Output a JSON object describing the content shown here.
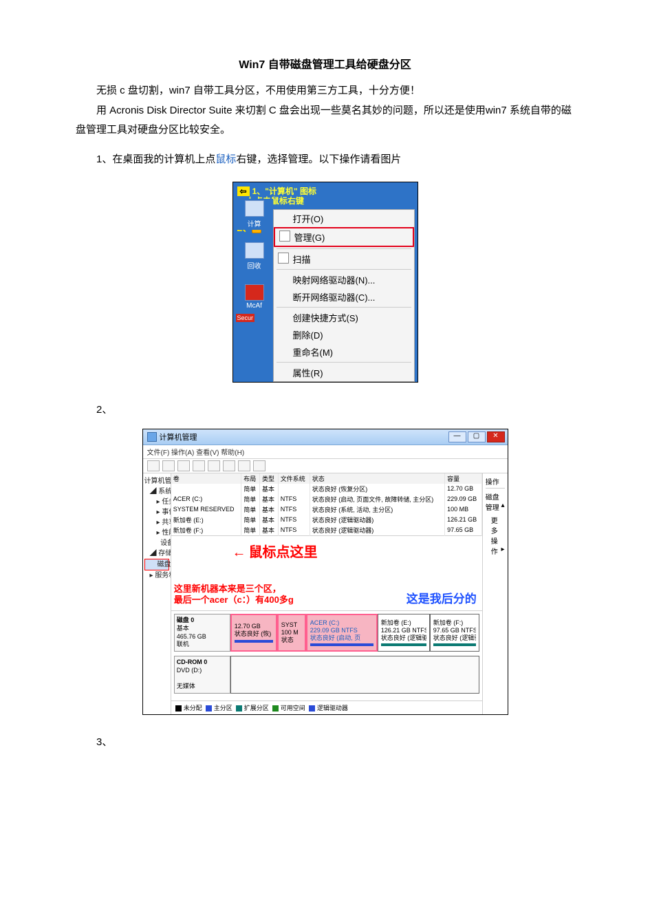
{
  "title": "Win7 自带磁盘管理工具给硬盘分区",
  "p1": "无损 c 盘切割，win7 自带工具分区，不用使用第三方工具，十分方便！",
  "p2": "用 Acronis Disk Director Suite 来切割 C 盘会出现一些莫名其妙的问题，所以还是使用win7 系统自带的磁盘管理工具对硬盘分区比较安全。",
  "step1_pre": "1、在桌面我的计算机上点",
  "step1_link": "鼠标",
  "step1_post": "右键，选择管理。以下操作请看图片",
  "step2": "2、",
  "step3": "3、",
  "fig1": {
    "tip_1a": "1、",
    "tip_1b": "\"计算机\" 图标",
    "tip_1c": "上点击鼠标右键",
    "tag2": "2、",
    "desk_comp": "计算",
    "desk_trash": "回收",
    "desk_mcafee_a": "McAf",
    "desk_mcafee_b": "Secur",
    "menu": {
      "open": "打开(O)",
      "manage": "管理(G)",
      "scan": "扫描",
      "map": "映射网络驱动器(N)...",
      "unmap": "断开网络驱动器(C)...",
      "shortcut": "创建快捷方式(S)",
      "delete": "删除(D)",
      "rename": "重命名(M)",
      "prop": "属性(R)"
    }
  },
  "fig2": {
    "title": "计算机管理",
    "menubar": "文件(F)  操作(A)  查看(V)  帮助(H)",
    "tree": {
      "root": "计算机管理(本地)",
      "systools": "系统工具",
      "task": "任务计划程序",
      "event": "事件查看器",
      "share": "共享文件夹",
      "perf": "性能",
      "devmgr": "设备管理器",
      "storage": "存储",
      "diskmgmt": "磁盘管理",
      "services": "服务和应用程序"
    },
    "callout_click": "鼠标点这里",
    "headers": {
      "vol": "卷",
      "layout": "布局",
      "type": "类型",
      "fs": "文件系统",
      "status": "状态",
      "cap": "容量"
    },
    "rows": [
      {
        "vol": "",
        "layout": "简单",
        "type": "基本",
        "fs": "",
        "status": "状态良好 (恢复分区)",
        "cap": "12.70 GB"
      },
      {
        "vol": "ACER (C:)",
        "layout": "简单",
        "type": "基本",
        "fs": "NTFS",
        "status": "状态良好 (启动, 页面文件, 故障转储, 主分区)",
        "cap": "229.09 GB"
      },
      {
        "vol": "SYSTEM RESERVED",
        "layout": "简单",
        "type": "基本",
        "fs": "NTFS",
        "status": "状态良好 (系统, 活动, 主分区)",
        "cap": "100 MB"
      },
      {
        "vol": "新加卷 (E:)",
        "layout": "简单",
        "type": "基本",
        "fs": "NTFS",
        "status": "状态良好 (逻辑驱动器)",
        "cap": "126.21 GB"
      },
      {
        "vol": "新加卷 (F:)",
        "layout": "简单",
        "type": "基本",
        "fs": "NTFS",
        "status": "状态良好 (逻辑驱动器)",
        "cap": "97.65 GB"
      }
    ],
    "annot_left_l1": "这里新机器本来是三个区，",
    "annot_left_l2": "最后一个acer（c：）有400多g",
    "annot_right": "这是我后分的",
    "disk0": {
      "name": "磁盘 0",
      "type": "基本",
      "size": "465.76 GB",
      "stat": "联机",
      "p_recovery_size": "12.70 GB",
      "p_recovery_stat": "状态良好 (恢)",
      "p_sys_name": "SYST",
      "p_sys_size": "100 M",
      "p_sys_stat": "状态",
      "p_c_name": "ACER (C:)",
      "p_c_size": "229.09 GB NTFS",
      "p_c_stat": "状态良好 (启动, 页",
      "p_e_name": "新加卷 (E:)",
      "p_e_size": "126.21 GB NTFS",
      "p_e_stat": "状态良好 (逻辑驱",
      "p_f_name": "新加卷 (F:)",
      "p_f_size": "97.65 GB NTFS",
      "p_f_stat": "状态良好 (逻辑驱"
    },
    "cd": {
      "name": "CD-ROM 0",
      "dev": "DVD (D:)",
      "stat": "无媒体"
    },
    "legend": {
      "unalloc": "未分配",
      "primary": "主分区",
      "ext": "扩展分区",
      "free": "可用空间",
      "logical": "逻辑驱动器"
    },
    "actions": {
      "hd": "操作",
      "dm": "磁盘管理",
      "more": "更多操作",
      "arrow": "▸",
      "caret": "▴"
    }
  }
}
